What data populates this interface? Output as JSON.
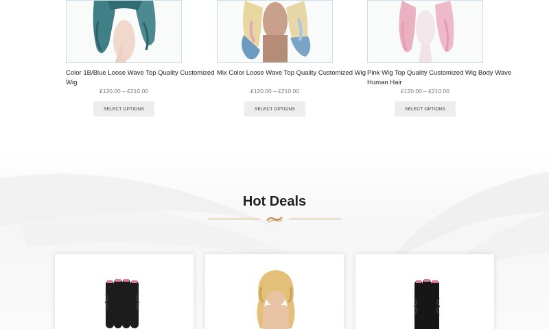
{
  "products": [
    {
      "name": "Color 1B/Blue Loose Wave Top Quality Customized Wig",
      "price": "£120.00 – £210.00",
      "button": "SELECT OPTIONS",
      "image": "teal-wig-image"
    },
    {
      "name": "Mix Color Loose Wave Top Quality Customized Wig",
      "price": "£120.00 – £210.00",
      "button": "SELECT OPTIONS",
      "image": "mixed-color-wig-image"
    },
    {
      "name": "Pink Wig Top Quality Customized Wig Body Wave Human Hair",
      "price": "£120.00 – £210.00",
      "button": "SELECT OPTIONS",
      "image": "pink-wig-image"
    }
  ],
  "deals": {
    "title": "Hot Deals",
    "divider_icon": "hair-wave-icon",
    "cards": [
      {
        "image": "black-curly-bundles-image"
      },
      {
        "image": "blonde-curly-wig-image"
      },
      {
        "image": "black-deep-wave-bundles-image"
      }
    ]
  },
  "colors": {
    "accent_gold": "#c9a46a",
    "button_bg": "#ededed",
    "thumb_border": "#cfdde6"
  }
}
